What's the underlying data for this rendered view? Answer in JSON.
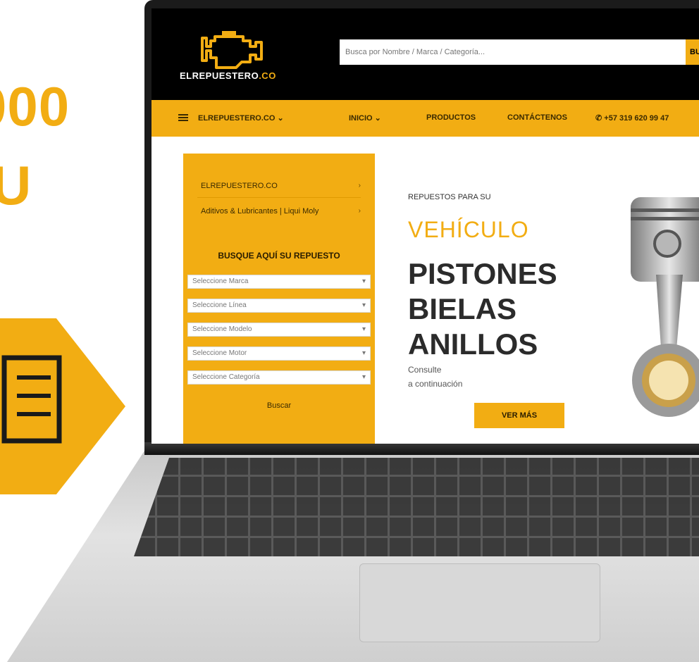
{
  "promo": {
    "line1": "000",
    "line2": "U"
  },
  "site": {
    "logo_text_main": "ELREPUESTERO",
    "logo_text_suffix": ".CO",
    "search_placeholder": "Busca por Nombre / Marca / Categoría...",
    "search_button": "BUS"
  },
  "nav": {
    "items": [
      {
        "label": "ELREPUESTERO.CO ⌄"
      },
      {
        "label": "INICIO ⌄"
      },
      {
        "label": "PRODUCTOS"
      },
      {
        "label": "CONTÁCTENOS"
      },
      {
        "label": "✆ +57 319 620 99 47"
      }
    ]
  },
  "sidebar": {
    "links": [
      {
        "label": "ELREPUESTERO.CO"
      },
      {
        "label": "Aditivos & Lubricantes | Liqui Moly"
      }
    ],
    "heading": "BUSQUE AQUÍ SU REPUESTO",
    "selects": [
      {
        "value": "Seleccione Marca"
      },
      {
        "value": "Seleccione Línea"
      },
      {
        "value": "Seleccione Modelo"
      },
      {
        "value": "Seleccione Motor"
      },
      {
        "value": "Seleccione Categoría"
      }
    ],
    "search_label": "Buscar"
  },
  "hero": {
    "kicker": "REPUESTOS PARA SU",
    "accent": "VEHÍCULO",
    "lines": [
      "PISTONES",
      "BIELAS",
      "ANILLOS"
    ],
    "note_line1": "Consulte",
    "note_line2": "a continuación",
    "cta": "VER MÁS"
  },
  "colors": {
    "accent": "#f2ad13",
    "header_bg": "#000000"
  }
}
